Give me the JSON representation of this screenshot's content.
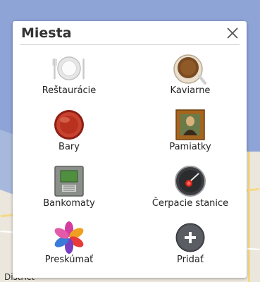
{
  "dialog": {
    "title": "Miesta",
    "close_icon": "close-icon"
  },
  "places": [
    {
      "label": "Reštaurácie",
      "icon": "plate-cutlery-icon"
    },
    {
      "label": "Kaviarne",
      "icon": "coffee-cup-icon"
    },
    {
      "label": "Bary",
      "icon": "bottle-cap-icon"
    },
    {
      "label": "Pamiatky",
      "icon": "framed-painting-icon"
    },
    {
      "label": "Bankomaty",
      "icon": "atm-icon"
    },
    {
      "label": "Čerpacie stanice",
      "icon": "fuel-gauge-icon"
    },
    {
      "label": "Preskúmať",
      "icon": "flower-explore-icon"
    },
    {
      "label": "Pridať",
      "icon": "add-icon"
    }
  ],
  "map": {
    "visible_labels": [
      "District"
    ]
  }
}
